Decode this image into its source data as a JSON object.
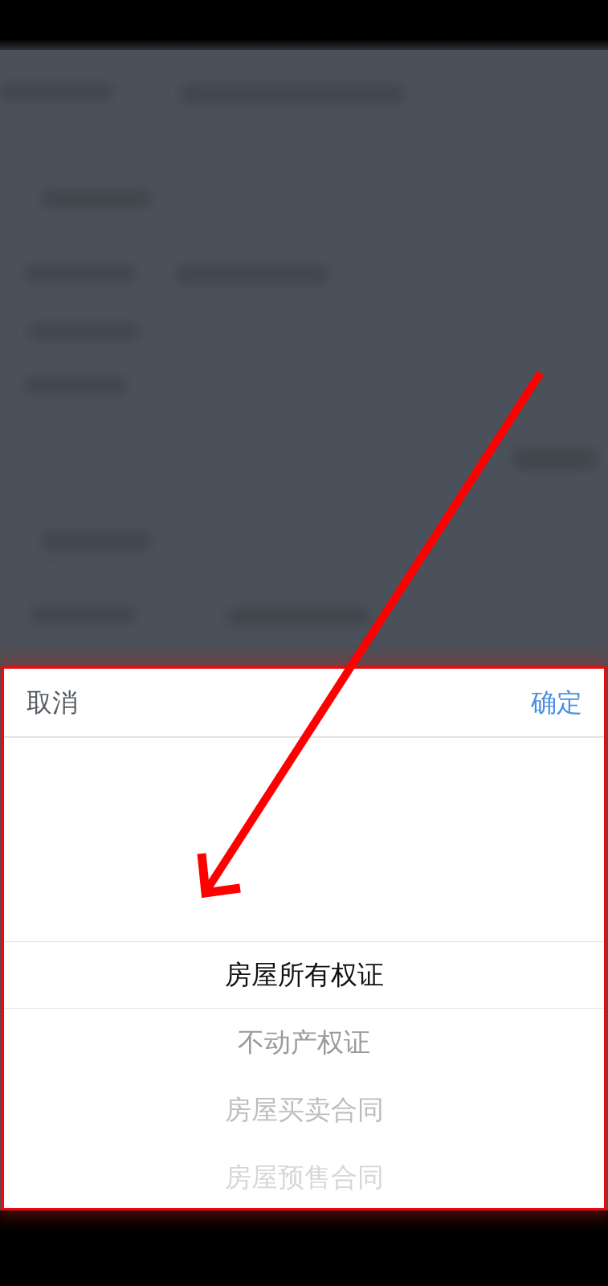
{
  "picker": {
    "cancel": "取消",
    "confirm": "确定",
    "options": [
      {
        "label": "房屋所有权证",
        "selected": true
      },
      {
        "label": "不动产权证",
        "selected": false
      },
      {
        "label": "房屋买卖合同",
        "selected": false
      },
      {
        "label": "房屋预售合同",
        "selected": false
      }
    ]
  }
}
